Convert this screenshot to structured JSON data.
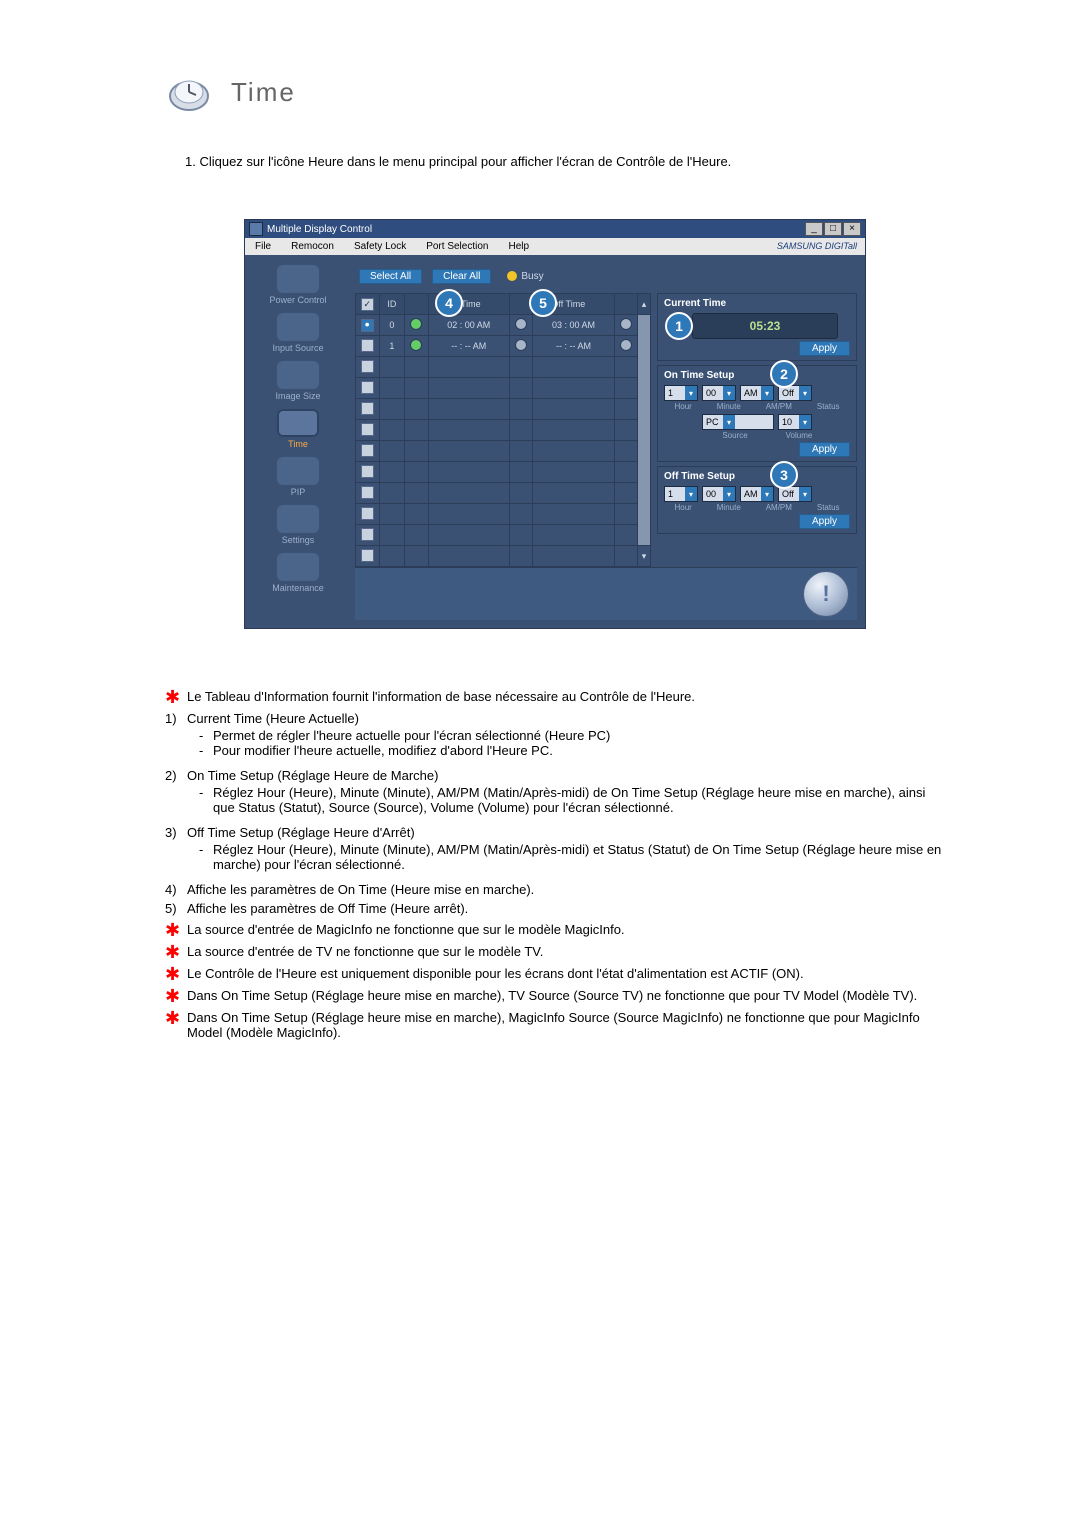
{
  "page_title": "Time",
  "intro": "1. Cliquez sur l'icône Heure dans le menu principal pour afficher l'écran de Contrôle de l'Heure.",
  "app": {
    "title": "Multiple Display Control",
    "menu": [
      "File",
      "Remocon",
      "Safety Lock",
      "Port Selection",
      "Help"
    ],
    "brand": "SAMSUNG DIGITall",
    "toolbar": {
      "select_all": "Select All",
      "clear_all": "Clear All",
      "busy": "Busy"
    },
    "sidebar": [
      {
        "label": "Power Control",
        "active": false
      },
      {
        "label": "Input Source",
        "active": false
      },
      {
        "label": "Image Size",
        "active": false
      },
      {
        "label": "Time",
        "active": true
      },
      {
        "label": "PIP",
        "active": false
      },
      {
        "label": "Settings",
        "active": false
      },
      {
        "label": "Maintenance",
        "active": false
      }
    ],
    "table": {
      "headers": {
        "chk": "✓",
        "id": "ID",
        "on": "On Time",
        "off": "Off Time"
      },
      "marker_on": "4",
      "marker_off": "5",
      "rows": [
        {
          "checked": true,
          "selected": true,
          "id": "0",
          "on_led": true,
          "on": "02 : 00 AM",
          "off_led": false,
          "off": "03 : 00 AM",
          "st3": false
        },
        {
          "checked": false,
          "selected": false,
          "id": "1",
          "on_led": true,
          "on": "-- : -- AM",
          "off_led": false,
          "off": "-- : -- AM",
          "st3": false
        }
      ],
      "blank_rows": 8
    },
    "markers": {
      "current": "1",
      "on_setup": "2",
      "off_setup": "3"
    },
    "right": {
      "current_time": {
        "title": "Current Time",
        "clock": "05:23",
        "apply": "Apply"
      },
      "on_time": {
        "title": "On Time Setup",
        "hour": "1",
        "minute": "00",
        "ampm": "AM",
        "status": "Off",
        "source": "PC",
        "volume": "10",
        "apply": "Apply",
        "labels": {
          "hour": "Hour",
          "minute": "Minute",
          "ampm": "AM/PM",
          "status": "Status",
          "source": "Source",
          "volume": "Volume"
        }
      },
      "off_time": {
        "title": "Off Time Setup",
        "hour": "1",
        "minute": "00",
        "ampm": "AM",
        "status": "Off",
        "apply": "Apply",
        "labels": {
          "hour": "Hour",
          "minute": "Minute",
          "ampm": "AM/PM",
          "status": "Status"
        }
      }
    },
    "footer_orb": "!"
  },
  "notes": {
    "star1": "Le Tableau d'Information fournit l'information de base nécessaire au Contrôle de l'Heure.",
    "n1_title": "Current Time (Heure Actuelle)",
    "n1_sub1": "Permet de régler l'heure actuelle pour l'écran sélectionné (Heure PC)",
    "n1_sub2": "Pour modifier l'heure actuelle, modifiez d'abord l'Heure PC.",
    "n2_title": "On Time Setup (Réglage Heure de Marche)",
    "n2_sub1": "Réglez Hour (Heure), Minute (Minute), AM/PM (Matin/Après-midi) de On Time Setup (Réglage heure mise en marche), ainsi que Status (Statut), Source (Source), Volume (Volume) pour l'écran sélectionné.",
    "n3_title": "Off Time Setup (Réglage Heure d'Arrêt)",
    "n3_sub1": "Réglez Hour (Heure), Minute (Minute), AM/PM (Matin/Après-midi) et Status (Statut) de On Time Setup (Réglage heure mise en marche) pour l'écran sélectionné.",
    "n4": "Affiche les paramètres de On Time (Heure mise en marche).",
    "n5": "Affiche les paramètres de Off Time (Heure arrêt).",
    "star2": "La source d'entrée de MagicInfo ne fonctionne que sur le modèle MagicInfo.",
    "star3": "La source d'entrée de TV ne fonctionne que sur le modèle TV.",
    "star4": "Le Contrôle de l'Heure est uniquement disponible pour les écrans dont l'état d'alimentation est ACTIF (ON).",
    "star5": "Dans On Time Setup (Réglage heure mise en marche), TV Source (Source TV) ne fonctionne que pour TV Model (Modèle TV).",
    "star6": "Dans On Time Setup (Réglage heure mise en marche), MagicInfo Source (Source MagicInfo) ne fonctionne que pour MagicInfo Model (Modèle MagicInfo)."
  },
  "labels": {
    "num1": "1)",
    "num2": "2)",
    "num3": "3)",
    "num4": "4)",
    "num5": "5)"
  }
}
